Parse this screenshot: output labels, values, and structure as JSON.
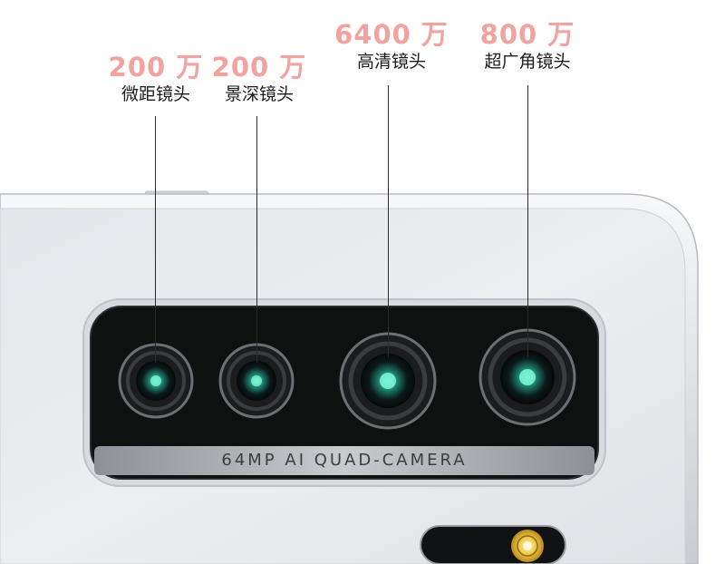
{
  "callouts": [
    {
      "megapixels": "200 万",
      "lens": "微距镜头"
    },
    {
      "megapixels": "200 万",
      "lens": "景深镜头"
    },
    {
      "megapixels": "6400 万",
      "lens": "高清镜头"
    },
    {
      "megapixels": "800 万",
      "lens": "超广角镜头"
    }
  ],
  "module": {
    "band_text": "64MP AI QUAD-CAMERA"
  },
  "colors": {
    "accent": "#f1a3a0",
    "label": "#1b1b1b",
    "body": "#e9ebee",
    "module": "#101010",
    "lens_glow": "#3fd1b0"
  }
}
